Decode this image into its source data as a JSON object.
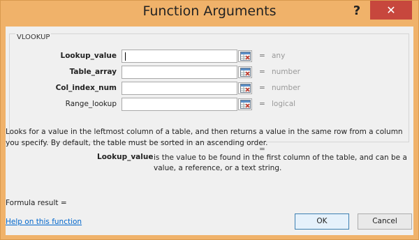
{
  "window": {
    "title": "Function Arguments",
    "help_glyph": "?",
    "close_glyph": "✕"
  },
  "group": {
    "label": "VLOOKUP"
  },
  "arguments": [
    {
      "label": "Lookup_value",
      "value": "",
      "eq": "=",
      "type": "any",
      "bold": true
    },
    {
      "label": "Table_array",
      "value": "",
      "eq": "=",
      "type": "number",
      "bold": true
    },
    {
      "label": "Col_index_num",
      "value": "",
      "eq": "=",
      "type": "number",
      "bold": true
    },
    {
      "label": "Range_lookup",
      "value": "",
      "eq": "=",
      "type": "logical",
      "bold": false
    }
  ],
  "result_eq": "=",
  "description": "Looks for a value in the leftmost column of a table, and then returns a value in the same row from a column you specify. By default, the table must be sorted in an ascending order.",
  "arg_description": {
    "name": "Lookup_value",
    "text": "is the value to be found in the first column of the table, and can be a value, a reference, or a text string."
  },
  "formula_result_label": "Formula result =",
  "help_link": "Help on this function",
  "buttons": {
    "ok": "OK",
    "cancel": "Cancel"
  },
  "colors": {
    "titlebar": "#f0b26a",
    "close": "#c7473d",
    "link": "#0066cc"
  }
}
